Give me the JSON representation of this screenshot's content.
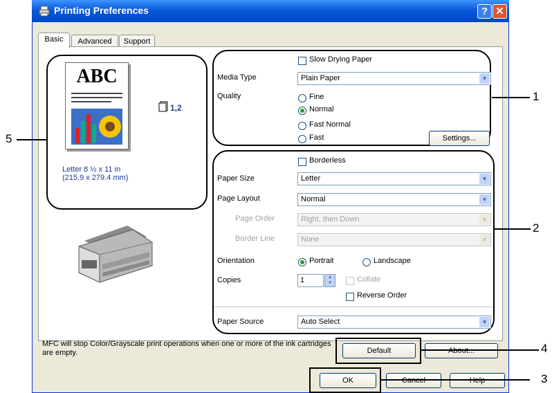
{
  "window": {
    "title": "Printing Preferences"
  },
  "title_buttons": {
    "help": "?",
    "close": "✕"
  },
  "tabs": [
    {
      "label": "Basic"
    },
    {
      "label": "Advanced"
    },
    {
      "label": "Support"
    }
  ],
  "preview": {
    "doc_text": "ABC",
    "copies_icon_text": "1,2",
    "paper_line1": "Letter 8 ½ x 11 in",
    "paper_line2": "(215.9 x 279.4 mm)"
  },
  "quality_group": {
    "slow_drying_label": "Slow Drying Paper",
    "slow_drying_checked": false,
    "media_type_label": "Media Type",
    "media_type_value": "Plain Paper",
    "quality_label": "Quality",
    "options": [
      "Fine",
      "Normal",
      "Fast Normal",
      "Fast"
    ],
    "selected": "Normal",
    "settings_button": "Settings..."
  },
  "paper_group": {
    "borderless_label": "Borderless",
    "borderless_checked": false,
    "paper_size_label": "Paper Size",
    "paper_size_value": "Letter",
    "page_layout_label": "Page Layout",
    "page_layout_value": "Normal",
    "page_order_label": "Page Order",
    "page_order_value": "Right, then Down",
    "border_line_label": "Border Line",
    "border_line_value": "None",
    "orientation_label": "Orientation",
    "portrait_label": "Portrait",
    "landscape_label": "Landscape",
    "orientation_selected": "Portrait",
    "copies_label": "Copies",
    "copies_value": "1",
    "collate_label": "Collate",
    "reverse_order_label": "Reverse Order",
    "paper_source_label": "Paper Source",
    "paper_source_value": "Auto Select"
  },
  "footer": {
    "message": "MFC will stop Color/Grayscale print operations when one or more of the ink cartridges are empty.",
    "default_button": "Default",
    "about_button": "About...",
    "ok_button": "OK",
    "cancel_button": "Cancel",
    "help_button": "Help"
  },
  "callouts": [
    "1",
    "2",
    "3",
    "4",
    "5"
  ],
  "colors": {
    "titlebar": "#0a5ad8",
    "dialog_bg": "#ece9d8",
    "close": "#e0532f"
  }
}
